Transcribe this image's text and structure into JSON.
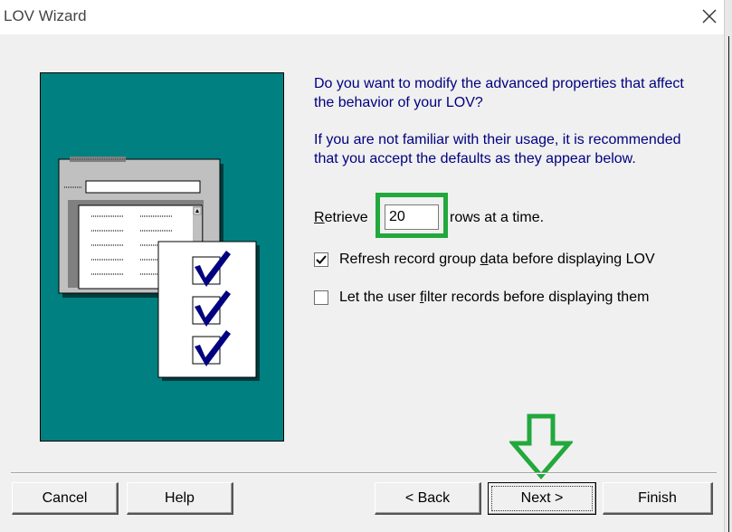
{
  "window": {
    "title": "LOV Wizard"
  },
  "prompt": {
    "question": "Do you want to modify the advanced properties that affect the behavior of your LOV?",
    "advice": "If you are not familiar with their usage, it is recommended that you accept the defaults as they appear below."
  },
  "retrieve": {
    "label_prefix": "R",
    "label_rest": "etrieve",
    "rows_value": "20",
    "suffix": "rows at a time."
  },
  "options": [
    {
      "label_before": "Refresh record group ",
      "mnemonic": "d",
      "label_after": "ata before displaying LOV",
      "checked": true
    },
    {
      "label_before": "Let the user ",
      "mnemonic": "f",
      "label_after": "ilter records before displaying them",
      "checked": false
    }
  ],
  "buttons": {
    "cancel": "Cancel",
    "help": "Help",
    "back": "< Back",
    "next": "Next >",
    "finish": "Finish"
  },
  "colors": {
    "illustration_bg": "#008080",
    "prompt_text": "#000080",
    "highlight": "#22a83c"
  },
  "icons": {
    "close": "close-icon",
    "illustration": "lov-wizard-illustration",
    "annotation_arrow": "down-arrow-icon",
    "checkmark": "checkmark-icon"
  }
}
